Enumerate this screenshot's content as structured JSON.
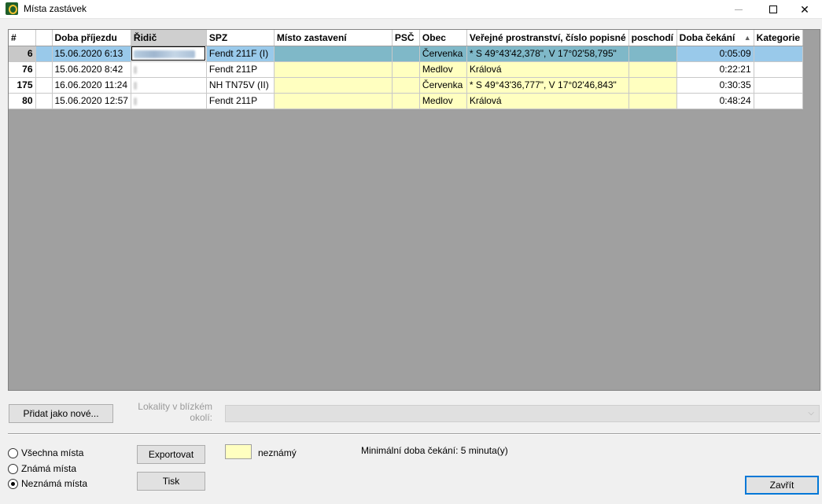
{
  "window": {
    "title": "Místa zastávek",
    "min_icon": "minimize-icon",
    "max_icon": "maximize-icon",
    "close_icon": "close-icon",
    "close_glyph": "✕"
  },
  "table": {
    "columns": [
      {
        "key": "no",
        "label": "#"
      },
      {
        "key": "flag",
        "label": ""
      },
      {
        "key": "arrival",
        "label": "Doba příjezdu"
      },
      {
        "key": "driver",
        "label": "Řidič"
      },
      {
        "key": "spz",
        "label": "SPZ"
      },
      {
        "key": "place",
        "label": "Místo zastavení"
      },
      {
        "key": "psc",
        "label": "PSČ"
      },
      {
        "key": "town",
        "label": "Obec"
      },
      {
        "key": "public",
        "label": "Veřejné prostranství, číslo popisné"
      },
      {
        "key": "floor",
        "label": "poschodí"
      },
      {
        "key": "wait",
        "label": "Doba čekání"
      },
      {
        "key": "cat",
        "label": "Kategorie"
      }
    ],
    "sort_indicator": "▲",
    "rows": [
      {
        "no": "6",
        "arrival": "15.06.2020 6:13",
        "spz": "Fendt 211F (I)",
        "place": "",
        "psc": "",
        "town": "Červenka",
        "public": "* S 49°43'42,378\", V 17°02'58,795\"",
        "floor": "",
        "wait": "0:05:09",
        "cat": ""
      },
      {
        "no": "76",
        "arrival": "15.06.2020 8:42",
        "spz": "Fendt 211P",
        "place": "",
        "psc": "",
        "town": "Medlov",
        "public": "Králová",
        "floor": "",
        "wait": "0:22:21",
        "cat": ""
      },
      {
        "no": "175",
        "arrival": "16.06.2020 11:24",
        "spz": "NH TN75V (II)",
        "place": "",
        "psc": "",
        "town": "Červenka",
        "public": "* S 49°43'36,777\", V 17°02'46,843\"",
        "floor": "",
        "wait": "0:30:35",
        "cat": ""
      },
      {
        "no": "80",
        "arrival": "15.06.2020 12:57",
        "spz": "Fendt 211P",
        "place": "",
        "psc": "",
        "town": "Medlov",
        "public": "Králová",
        "floor": "",
        "wait": "0:48:24",
        "cat": ""
      }
    ]
  },
  "controls": {
    "add_new_label": "Přidat jako nové...",
    "nearby_label": "Lokality v blízkém okolí:",
    "nearby_value": "",
    "export_label": "Exportovat",
    "print_label": "Tisk",
    "close_label": "Zavřít",
    "legend_unknown": "neznámý",
    "min_wait": "Minimální doba čekání: 5 minuta(y)",
    "radios": [
      {
        "label": "Všechna místa",
        "checked": false
      },
      {
        "label": "Známá místa",
        "checked": false
      },
      {
        "label": "Neznámá místa",
        "checked": true
      }
    ]
  },
  "colors": {
    "unknown_yellow": "#ffffc0",
    "selected_row": "#99c9ea",
    "grid_bg": "#a0a0a0"
  }
}
